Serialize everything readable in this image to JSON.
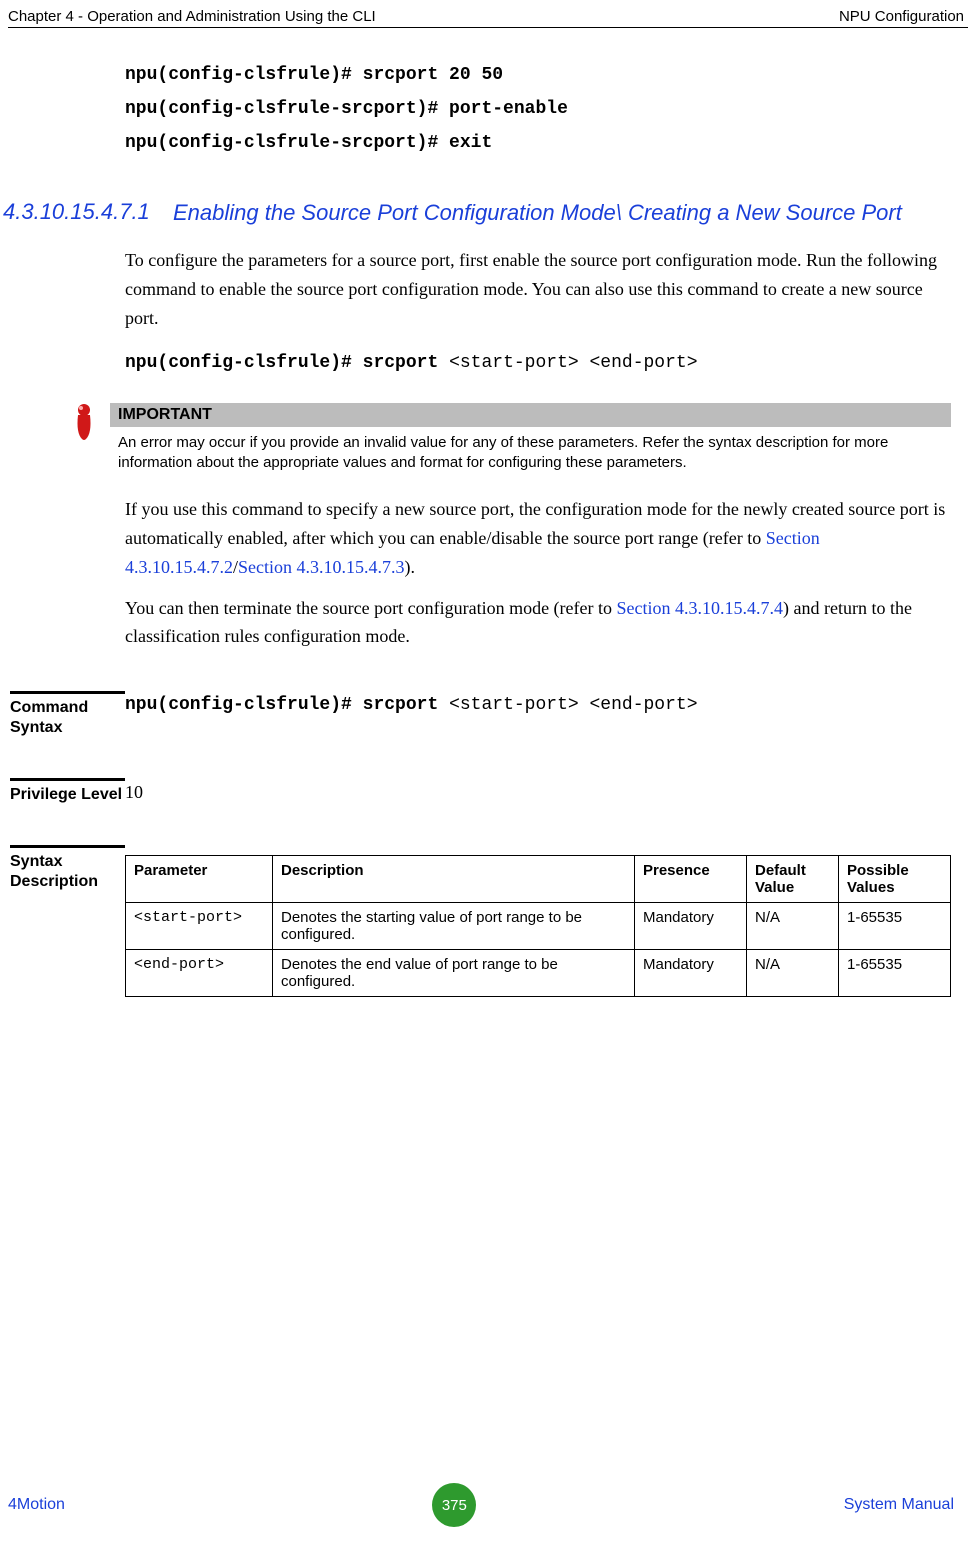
{
  "header": {
    "left": "Chapter 4 - Operation and Administration Using the CLI",
    "right": "NPU Configuration"
  },
  "intro_cmds": {
    "line1": "npu(config-clsfrule)# srcport 20 50",
    "line2": "npu(config-clsfrule-srcport)# port-enable",
    "line3": "npu(config-clsfrule-srcport)# exit"
  },
  "section": {
    "number": "4.3.10.15.4.7.1",
    "title": "Enabling the Source Port Configuration Mode\\ Creating a New Source Port"
  },
  "para1": "To configure the parameters for a source port, first enable the source port configuration mode. Run the following command to enable the source port configuration mode. You can also use this command to create a new source port.",
  "cmd1_prefix": "npu(config-clsfrule)# srcport ",
  "cmd1_args": "<start-port> <end-port>",
  "important": {
    "head": "IMPORTANT",
    "body": "An error may occur if you provide an invalid value for any of these parameters. Refer the syntax description for more information about the appropriate values and format for configuring these parameters."
  },
  "para2a": "If you use this command to specify a new source port, the configuration mode for the newly created source port is automatically enabled, after which you can enable/disable the source port range (refer to ",
  "para2_link1": "Section 4.3.10.15.4.7.2",
  "para2_sep": "/",
  "para2_link2": "Section 4.3.10.15.4.7.3",
  "para2_end": ").",
  "para3a": "You can then terminate the source port configuration mode (refer to ",
  "para3_link": "Section 4.3.10.15.4.7.4",
  "para3b": ") and return to the classification rules configuration mode.",
  "meta": {
    "cmd_label": "Command Syntax",
    "cmd_prefix": "npu(config-clsfrule)# srcport ",
    "cmd_args": "<start-port> <end-port>",
    "priv_label": "Privilege Level",
    "priv_value": "10",
    "syntax_label": "Syntax Description"
  },
  "table": {
    "headers": {
      "parameter": "Parameter",
      "description": "Description",
      "presence": "Presence",
      "default": "Default Value",
      "possible": "Possible Values"
    },
    "rows": [
      {
        "parameter": "<start-port>",
        "description": "Denotes the starting value of port range to be configured.",
        "presence": "Mandatory",
        "default": "N/A",
        "possible": "1-65535"
      },
      {
        "parameter": "<end-port>",
        "description": "Denotes the end value of port range to be configured.",
        "presence": "Mandatory",
        "default": "N/A",
        "possible": "1-65535"
      }
    ]
  },
  "footer": {
    "left": "4Motion",
    "page": "375",
    "right": " System Manual"
  }
}
